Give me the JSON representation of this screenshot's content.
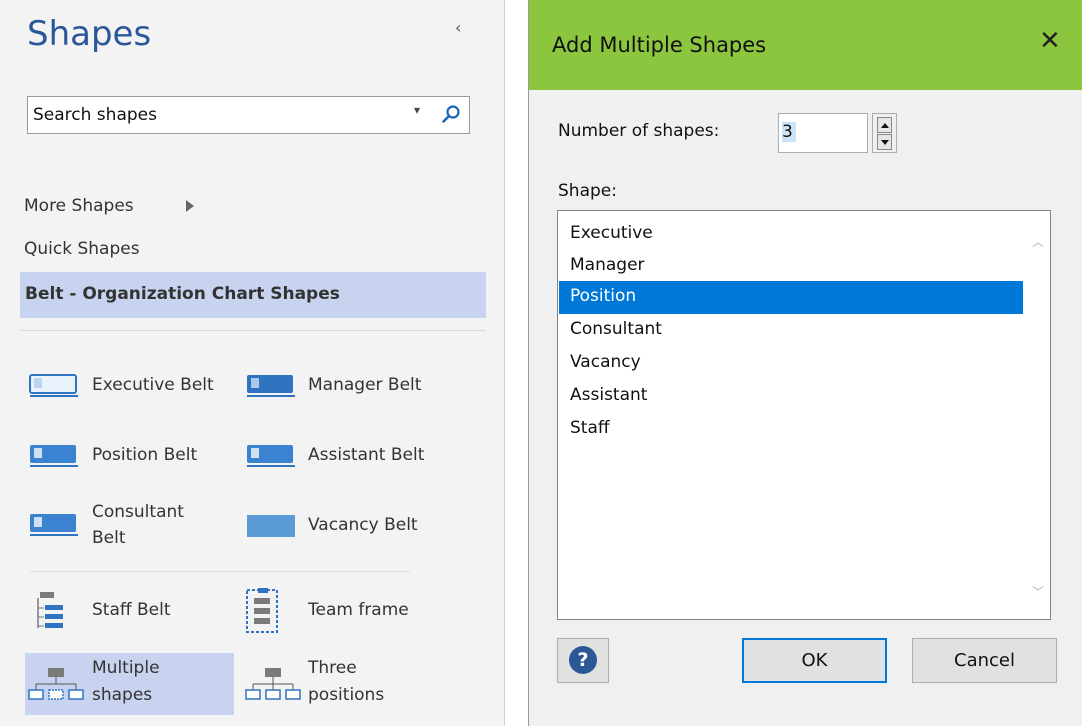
{
  "shapes_pane": {
    "title": "Shapes",
    "collapse_glyph": "‹",
    "search_placeholder": "Search shapes",
    "nav": {
      "more_shapes": "More Shapes",
      "quick_shapes": "Quick Shapes",
      "active_stencil": "Belt - Organization Chart Shapes"
    },
    "shapes": [
      {
        "label": "Executive Belt",
        "icon": "executive-belt-icon"
      },
      {
        "label": "Manager Belt",
        "icon": "manager-belt-icon"
      },
      {
        "label": "Position Belt",
        "icon": "position-belt-icon"
      },
      {
        "label": "Assistant Belt",
        "icon": "assistant-belt-icon"
      },
      {
        "label_line1": "Consultant",
        "label_line2": "Belt",
        "icon": "consultant-belt-icon"
      },
      {
        "label": "Vacancy Belt",
        "icon": "vacancy-belt-icon"
      },
      {
        "label": "Staff Belt",
        "icon": "staff-belt-icon"
      },
      {
        "label": "Team frame",
        "icon": "team-frame-icon"
      },
      {
        "label_line1": "Multiple",
        "label_line2": "shapes",
        "icon": "multiple-shapes-icon",
        "selected": true
      },
      {
        "label_line1": "Three",
        "label_line2": "positions",
        "icon": "three-positions-icon"
      }
    ]
  },
  "dialog": {
    "title": "Add Multiple Shapes",
    "close_glyph": "✕",
    "number_label": "Number of shapes:",
    "number_value": "3",
    "shape_label": "Shape:",
    "options": [
      "Executive",
      "Manager",
      "Position",
      "Consultant",
      "Vacancy",
      "Assistant",
      "Staff"
    ],
    "selected_option": "Position",
    "help_glyph": "?",
    "ok_label": "OK",
    "cancel_label": "Cancel"
  },
  "colors": {
    "title_bar": "#8cc63f",
    "selection": "#0078d7",
    "stencil_highlight": "#c8d3ef",
    "pane_title": "#2b579a"
  }
}
